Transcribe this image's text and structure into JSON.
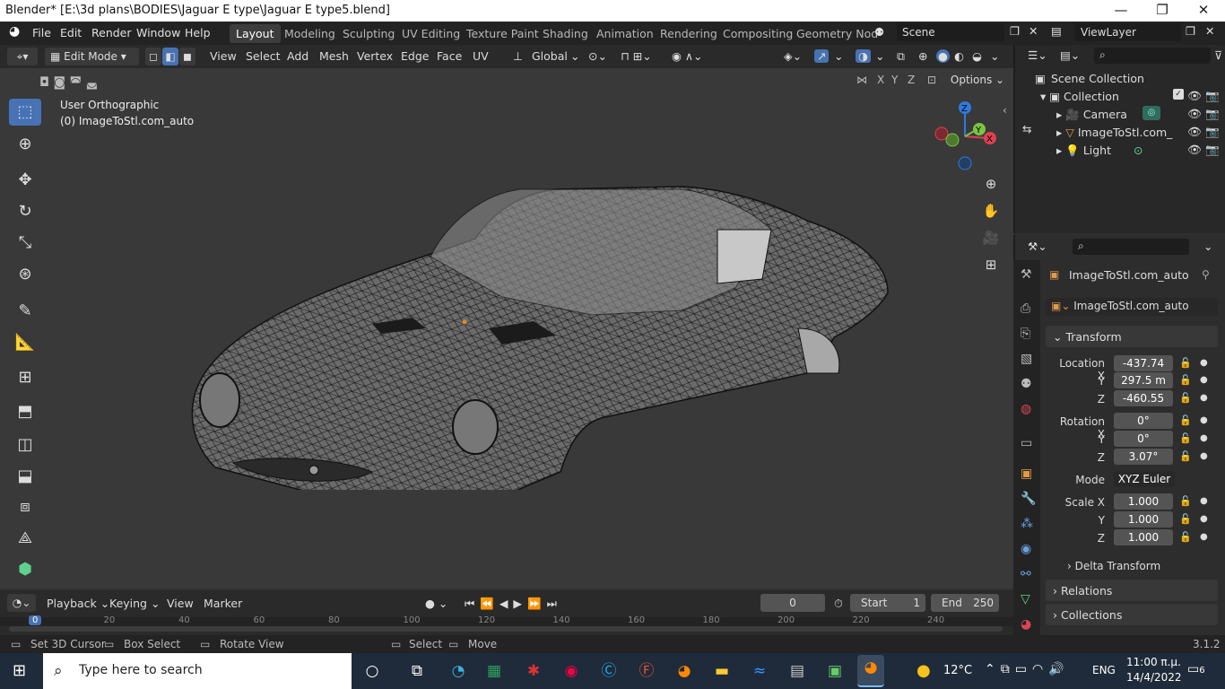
{
  "window": {
    "title": "Blender* [E:\\3d plans\\BODIES\\Jaguar E type\\Jaguar E  type5.blend]",
    "minimize": "—",
    "maximize": "❐",
    "close": "✕"
  },
  "menus": [
    "File",
    "Edit",
    "Render",
    "Window",
    "Help"
  ],
  "workspaces": [
    "Layout",
    "Modeling",
    "Sculpting",
    "UV Editing",
    "Texture Paint",
    "Shading",
    "Animation",
    "Rendering",
    "Compositing",
    "Geometry Nod"
  ],
  "scene": "Scene",
  "view_layer": "ViewLayer",
  "header": {
    "mode": "Edit Mode",
    "menus": [
      "View",
      "Select",
      "Add",
      "Mesh",
      "Vertex",
      "Edge",
      "Face",
      "UV"
    ],
    "orientation": "Global",
    "options": "Options",
    "axes": [
      "X",
      "Y",
      "Z"
    ]
  },
  "viewport": {
    "view_name": "User Orthographic",
    "object_label": "(0) ImageToStl.com_auto"
  },
  "outliner": {
    "root": "Scene Collection",
    "collection": "Collection",
    "items": [
      "Camera",
      "ImageToStl.com_",
      "Light"
    ]
  },
  "properties": {
    "object_name": "ImageToStl.com_auto",
    "data_name": "ImageToStl.com_auto",
    "transform_header": "Transform",
    "location_label": "Location X",
    "location": [
      "-437.74",
      "297.5 m",
      "-460.55"
    ],
    "rotation_label": "Rotation X",
    "rotation": [
      "0°",
      "0°",
      "3.07°"
    ],
    "mode_label": "Mode",
    "mode": "XYZ Euler",
    "scale_label": "Scale X",
    "scale": [
      "1.000",
      "1.000",
      "1.000"
    ],
    "axis_y": "Y",
    "axis_z": "Z",
    "sections": [
      "Delta Transform",
      "Relations",
      "Collections"
    ]
  },
  "timeline": {
    "menus": [
      "Playback",
      "Keying",
      "View",
      "Marker"
    ],
    "current_frame": "0",
    "start_label": "Start",
    "start": "1",
    "end_label": "End",
    "end": "250",
    "ruler": [
      "0",
      "20",
      "40",
      "60",
      "80",
      "100",
      "120",
      "140",
      "160",
      "180",
      "200",
      "220",
      "240"
    ]
  },
  "status": {
    "items": [
      "Set 3D Cursor",
      "Box Select",
      "Rotate View",
      "Select",
      "Move"
    ],
    "version": "3.1.2"
  },
  "taskbar": {
    "search_placeholder": "Type here to search",
    "weather": "12°C",
    "lang": "ENG",
    "time": "11:00 π.μ.",
    "date": "14/4/2022",
    "notifications": "6"
  }
}
